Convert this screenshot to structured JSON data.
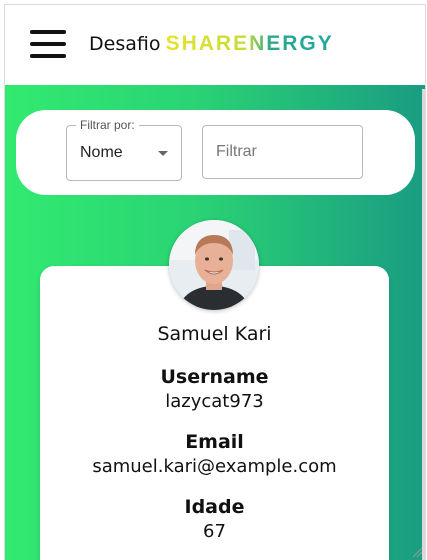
{
  "header": {
    "brand_prefix": "Desafio",
    "brand_logo": "SHARENERGY",
    "menu_icon": "hamburger-menu-icon"
  },
  "filter": {
    "legend": "Filtrar por:",
    "selected": "Nome",
    "input_placeholder": "Filtrar",
    "input_value": ""
  },
  "user": {
    "name": "Samuel Kari",
    "username_label": "Username",
    "username": "lazycat973",
    "email_label": "Email",
    "email": "samuel.kari@example.com",
    "age_label": "Idade",
    "age": "67",
    "avatar_alt": "Samuel Kari"
  },
  "colors": {
    "gradient_start": "#32ea70",
    "gradient_end": "#1a9c82",
    "brand_yellow": "#e6e22a",
    "brand_teal": "#22a8a0"
  }
}
